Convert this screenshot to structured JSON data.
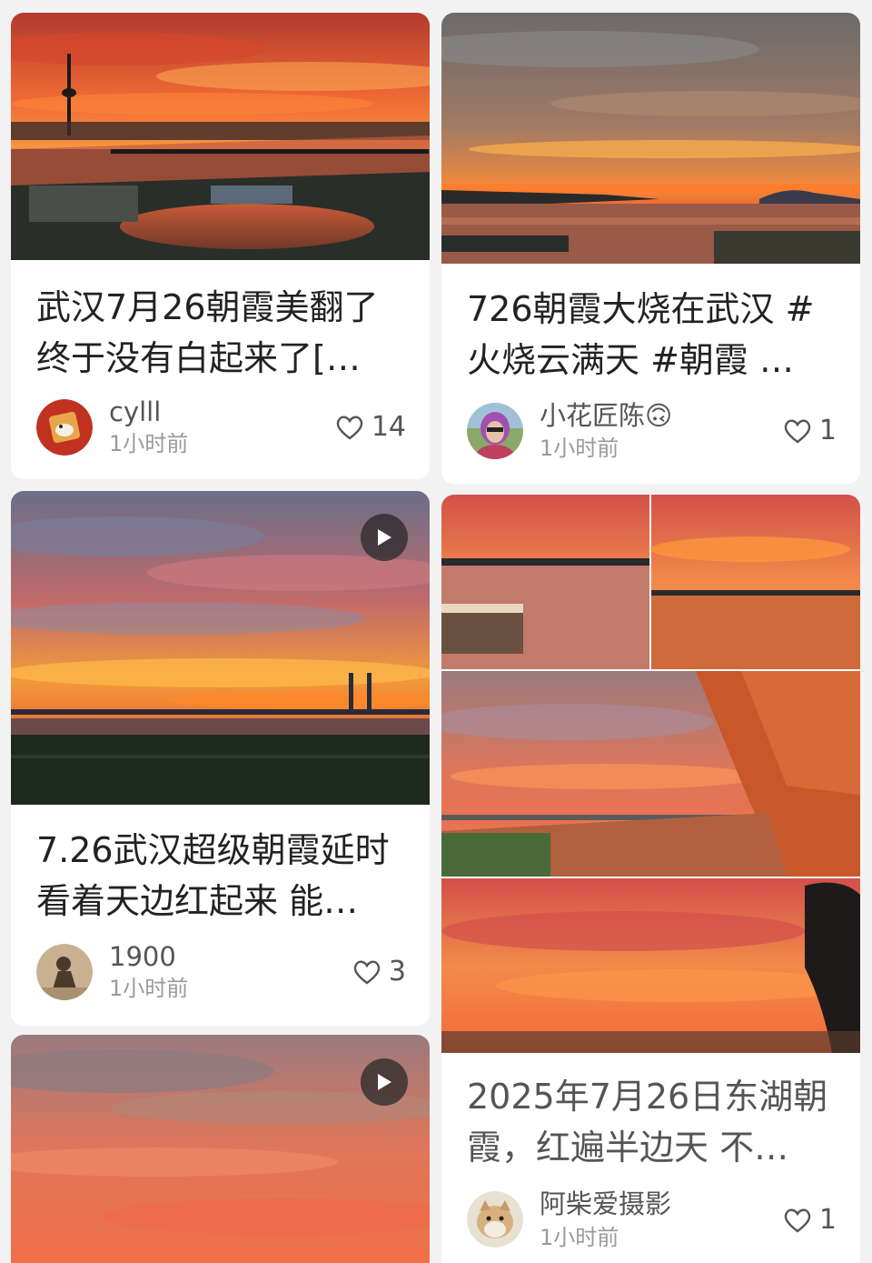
{
  "cards": [
    {
      "title_line1": "武汉7月26朝霞美翻了",
      "title_line2": "终于没有白起来了[…",
      "author": "cylll",
      "time": "1小时前",
      "likes": "14"
    },
    {
      "title_line1": "726朝霞大烧在武汉 #",
      "title_line2": "火烧云满天 #朝霞 …",
      "author": "小花匠陈🙃",
      "time": "1小时前",
      "likes": "1"
    },
    {
      "title_line1": "7.26武汉超级朝霞延时",
      "title_line2": "看着天边红起来 能…",
      "author": "1900",
      "time": "1小时前",
      "likes": "3"
    },
    {
      "title_line1": "2025年7月26日东湖朝",
      "title_line2": "霞，红遍半边天 不…",
      "author": "阿柴爱摄影",
      "time": "1小时前",
      "likes": "1"
    }
  ],
  "icons": {
    "like": "heart-outline-icon",
    "play": "play-icon"
  },
  "colors": {
    "sky_orange": "#f0582a",
    "sky_deep": "#c83a2a",
    "background": "#f2f2f2"
  }
}
